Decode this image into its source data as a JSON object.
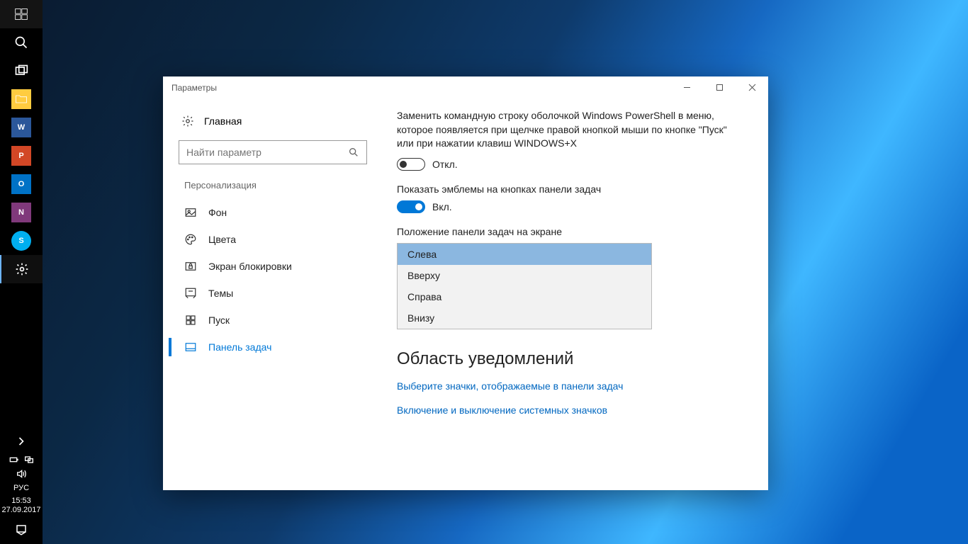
{
  "taskbar": {
    "apps": [
      {
        "name": "start",
        "icon": "windows"
      },
      {
        "name": "search",
        "icon": "search"
      },
      {
        "name": "taskview",
        "icon": "taskview"
      },
      {
        "name": "explorer",
        "icon": "explorer",
        "tile_bg": "#0078d7"
      },
      {
        "name": "word",
        "label": "W",
        "tile_bg": "#2b579a"
      },
      {
        "name": "powerpoint",
        "label": "P",
        "tile_bg": "#d24726"
      },
      {
        "name": "outlook",
        "label": "O",
        "tile_bg": "#0072c6"
      },
      {
        "name": "onenote",
        "label": "N",
        "tile_bg": "#80397b"
      },
      {
        "name": "skype",
        "label": "S",
        "tile_bg": "#00aff0"
      },
      {
        "name": "settings",
        "icon": "gear",
        "active": true
      }
    ],
    "lang": "РУС",
    "time": "15:53",
    "date": "27.09.2017"
  },
  "window": {
    "title": "Параметры",
    "side": {
      "home": "Главная",
      "search_placeholder": "Найти параметр",
      "section": "Персонализация",
      "items": [
        {
          "label": "Фон",
          "icon": "picture"
        },
        {
          "label": "Цвета",
          "icon": "palette"
        },
        {
          "label": "Экран блокировки",
          "icon": "lock"
        },
        {
          "label": "Темы",
          "icon": "theme"
        },
        {
          "label": "Пуск",
          "icon": "start"
        },
        {
          "label": "Панель задач",
          "icon": "taskbar",
          "selected": true
        }
      ]
    },
    "main": {
      "setting1_text": "Заменить командную строку оболочкой Windows PowerShell в меню, которое появляется при щелчке правой кнопкой мыши по кнопке \"Пуск\" или при нажатии клавиш WINDOWS+X",
      "setting1_state": "Откл.",
      "setting1_on": false,
      "setting2_label": "Показать эмблемы на кнопках панели задач",
      "setting2_state": "Вкл.",
      "setting2_on": true,
      "dropdown_label": "Положение панели задач на экране",
      "dropdown_options": [
        "Слева",
        "Вверху",
        "Справа",
        "Внизу"
      ],
      "dropdown_selected_index": 0,
      "section_heading": "Область уведомлений",
      "link1": "Выберите значки, отображаемые в панели задач",
      "link2": "Включение и выключение системных значков"
    }
  }
}
